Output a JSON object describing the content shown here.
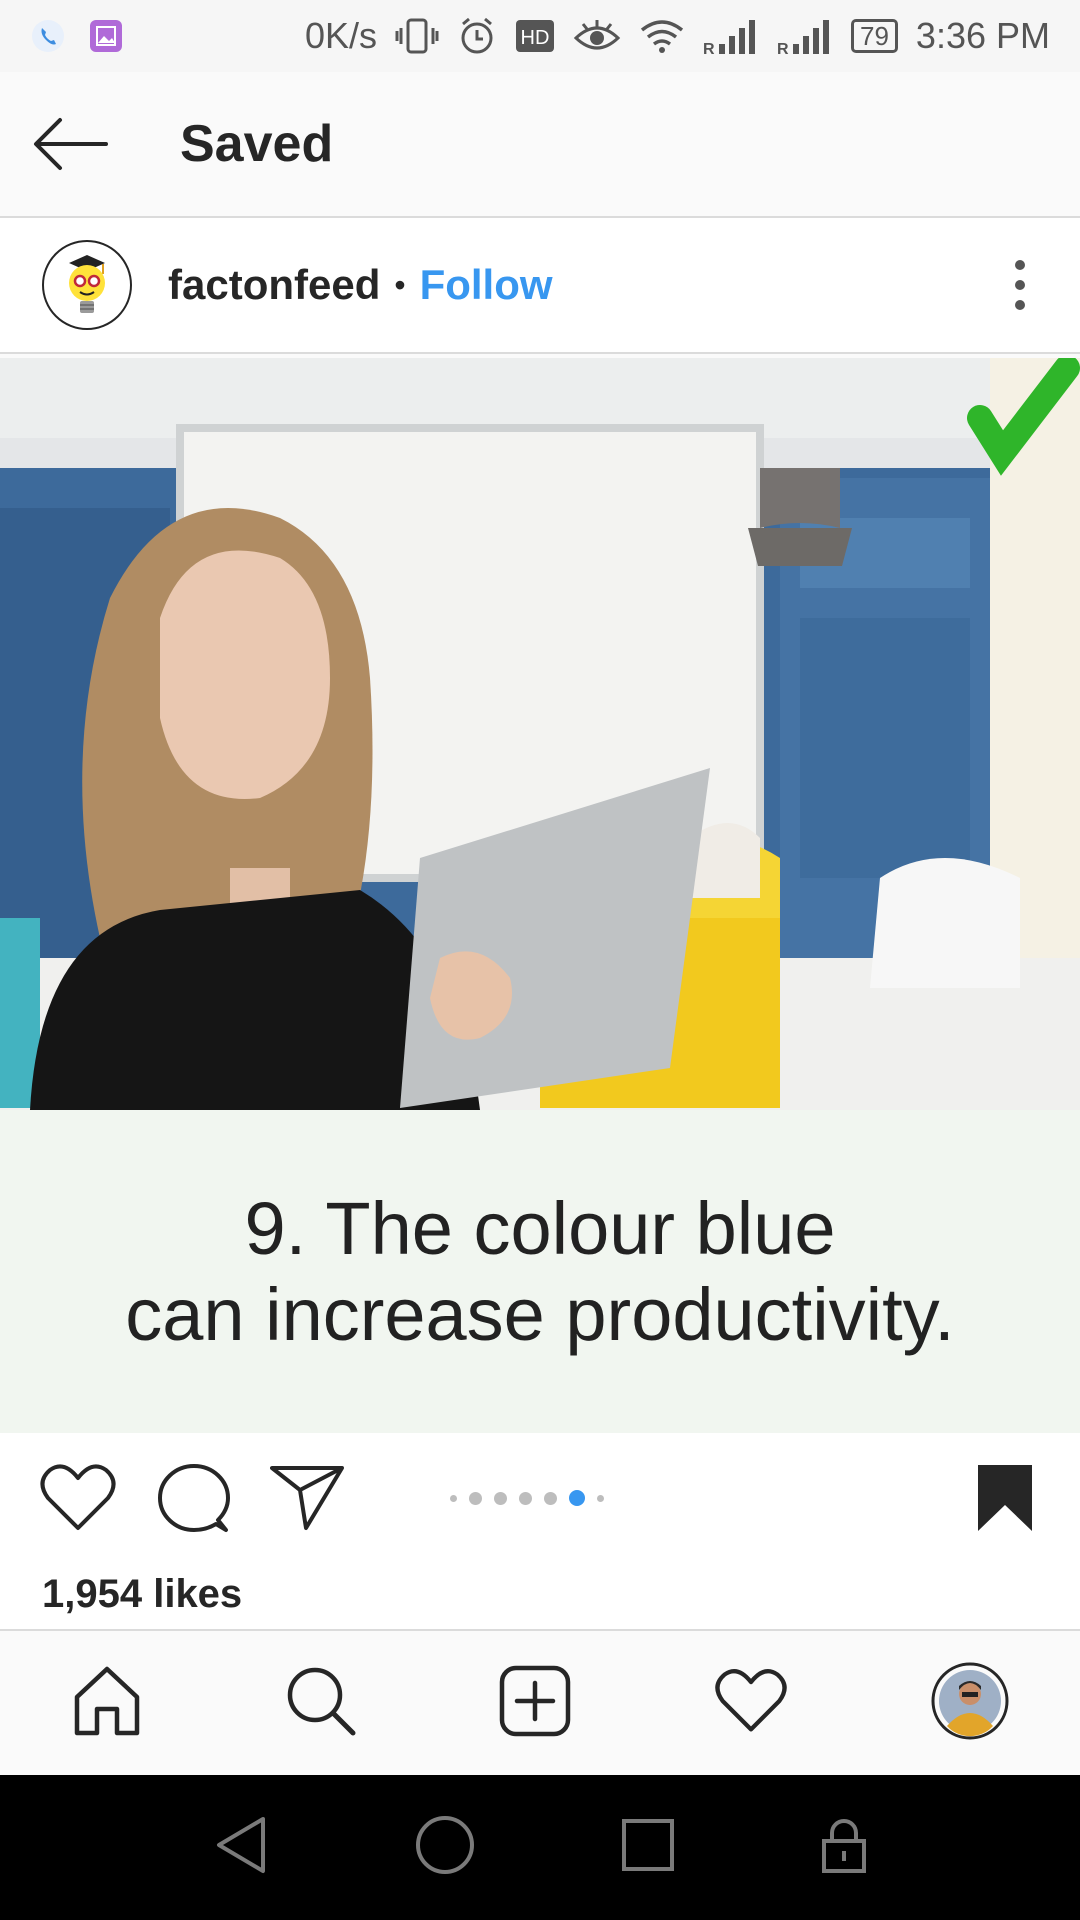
{
  "status_bar": {
    "speed": "0K/s",
    "hd_label": "HD",
    "battery": "79",
    "time": "3:36 PM",
    "signal_label_1": "R",
    "signal_label_2": "R"
  },
  "header": {
    "title": "Saved"
  },
  "post": {
    "username": "factonfeed",
    "separator": "•",
    "follow_label": "Follow",
    "caption_line_1": "9. The colour blue",
    "caption_line_2": "can increase productivity.",
    "likes": "1,954 likes",
    "carousel": {
      "count": 7,
      "active_index": 5
    }
  },
  "colors": {
    "accent": "#3897f0",
    "text": "#262626",
    "check_green": "#2fb52a"
  },
  "icons": [
    "phone-icon",
    "gallery-icon",
    "vibrate-icon",
    "alarm-icon",
    "hd-icon",
    "eye-icon",
    "wifi-icon",
    "signal-icon",
    "battery-icon",
    "back-arrow-icon",
    "more-options-icon",
    "heart-icon",
    "comment-icon",
    "share-icon",
    "bookmark-icon",
    "home-icon",
    "search-icon",
    "add-post-icon",
    "activity-heart-icon",
    "profile-avatar-icon",
    "nav-back-icon",
    "nav-home-icon",
    "nav-recents-icon",
    "lock-icon"
  ]
}
